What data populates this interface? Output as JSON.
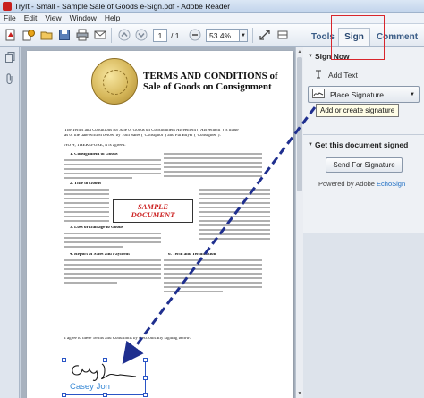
{
  "window": {
    "title": "TryIt - Small - Sample Sale of Goods e-Sign.pdf - Adobe Reader"
  },
  "menu": {
    "items": [
      "File",
      "Edit",
      "View",
      "Window",
      "Help"
    ]
  },
  "toolbar": {
    "page_current": "1",
    "page_total": "/ 1",
    "zoom": "53.4%"
  },
  "tabs": {
    "tools": "Tools",
    "sign": "Sign",
    "comment": "Comment"
  },
  "document": {
    "title_line1": "TERMS AND CONDITIONS of",
    "title_line2": "Sale of Goods on Consignment",
    "intro": "The Terms and Conditions for Sale of Goods on Consignment Agreement (\"Agreement\") is made",
    "intro2": "as of the date written below, by Tom Sales (\"Consignor\") and Pat Buyer (\"Consignee\").",
    "whereas": "NOW, THEREFORE, it is agreed:",
    "sections": [
      "1.  Consignment of Goods",
      "2.  Title to Goods",
      "3.  Loss or Damage to Goods",
      "4.  Report of Sales and Payment",
      "6.  Term and Termination"
    ],
    "stamp_line1": "SAMPLE",
    "stamp_line2": "DOCUMENT",
    "agree": "I agree to these Terms and Conditions by electronically signing below:",
    "signer_name": "Casey Jon"
  },
  "panel": {
    "sign_now": "Sign Now",
    "add_text": "Add Text",
    "place_signature": "Place Signature",
    "tooltip": "Add or create signature",
    "get_signed": "Get this document signed",
    "send_button": "Send For Signature",
    "powered_prefix": "Powered by Adobe ",
    "powered_brand": "EchoSign"
  },
  "colors": {
    "highlight": "#d8262c",
    "arrow": "#1f2f8f",
    "stamp": "#cc2222"
  }
}
